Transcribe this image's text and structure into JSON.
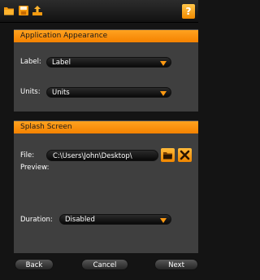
{
  "toolbar": {
    "icons": [
      "folder-open-icon",
      "save-icon",
      "export-icon"
    ],
    "help_label": "?"
  },
  "appearance": {
    "header": "Application Appearance",
    "label_caption": "Label:",
    "label_value": "Label",
    "units_caption": "Units:",
    "units_value": "Units"
  },
  "splash": {
    "header": "Splash Screen",
    "file_caption": "File:",
    "file_value": "C:\\Users\\John\\Desktop\\",
    "preview_caption": "Preview:",
    "duration_caption": "Duration:",
    "duration_value": "Disabled"
  },
  "nav": {
    "back_label": "Back",
    "cancel_label": "Cancel",
    "next_label": "Next"
  },
  "colors": {
    "accent": "#f58200",
    "panel": "#3f3f3f",
    "background": "#141414"
  }
}
